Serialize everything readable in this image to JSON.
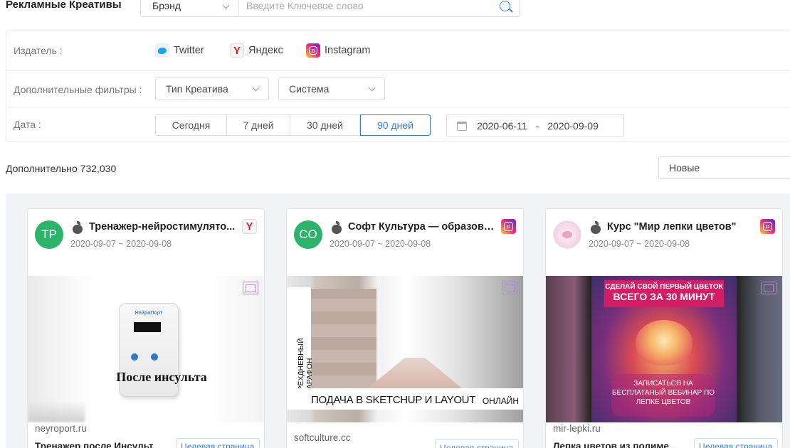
{
  "header": {
    "title": "Рекламные Креативы",
    "search_type": "Брэнд",
    "search_placeholder": "Введите Ключевое слово"
  },
  "filters": {
    "publisher_label": "Издатель :",
    "publishers": [
      {
        "name": "Twitter",
        "icon": "twitter-icon"
      },
      {
        "name": "Яндекс",
        "icon": "yandex-icon"
      },
      {
        "name": "Instagram",
        "icon": "instagram-icon"
      }
    ],
    "extra_label": "Дополнительные фильтры :",
    "creative_type": "Тип Креатива",
    "system": "Система",
    "date_label": "Дата :",
    "ranges": [
      "Сегодня",
      "7 дней",
      "30 дней",
      "90 дней"
    ],
    "active_range": "90 дней",
    "date_from": "2020-06-11",
    "date_sep": "-",
    "date_to": "2020-09-09"
  },
  "results": {
    "count_text": "Дополнительно 732,030",
    "sort": "Новые"
  },
  "cards": [
    {
      "avatar": "TP",
      "title": "Тренажер-нейростимулято...",
      "date": "2020-09-07 ~ 2020-09-08",
      "platform": "yandex",
      "platform_letter": "Y",
      "media": {
        "brand": "НейроПорт",
        "caption": "После инсульта"
      },
      "domain": "neyroport.ru",
      "landing": "Целевая страница",
      "description": "Тренажер после Инсульт..."
    },
    {
      "avatar": "CO",
      "title": "Софт Культура — образова...",
      "date": "2020-09-07 ~ 2020-09-08",
      "platform": "instagram",
      "media": {
        "vertical": "ТРЁХДНЕВНЫЙ МАРАФОН",
        "strip": "ПОДАЧА В SKETCHUP И LAYOUT",
        "online": "ОНЛАЙН"
      },
      "domain": "softculture.cc",
      "landing": "Целевая страница"
    },
    {
      "avatar": "",
      "title": "Курс \"Мир лепки цветов\"",
      "date": "2020-09-07 ~ 2020-09-08",
      "platform": "instagram",
      "media": {
        "head1": "СДЕЛАЙ СВОЙ ПЕРВЫЙ ЦВЕТОК",
        "head2": "ВСЕГО ЗА 30 МИНУТ",
        "cta": "ЗАПИСАТЬСЯ НА БЕСПЛАТАНЫЙ ВЕБИНАР ПО ЛЕПКЕ ЦВЕТОВ"
      },
      "domain": "mir-lepki.ru",
      "landing": "Целевая страница",
      "description": "Лепка цветов из полиме..."
    }
  ]
}
